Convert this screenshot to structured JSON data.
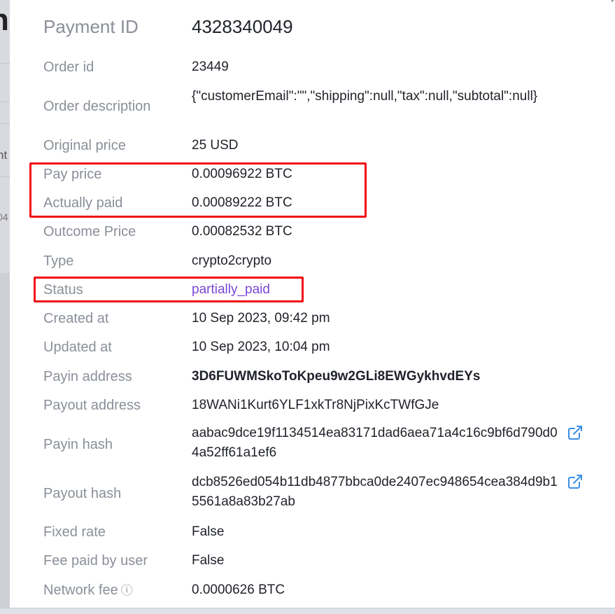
{
  "background": {
    "fragment_heading": "n",
    "fragment_tab": "nt",
    "fragment_number": "04"
  },
  "modal": {
    "close_glyph": "×",
    "title": {
      "label": "Payment ID",
      "value": "4328340049"
    },
    "rows": {
      "order_id": {
        "label": "Order id",
        "value": "23449"
      },
      "order_description": {
        "label": "Order description",
        "value": "{\"customerEmail\":\"\",\"shipping\":null,\"tax\":null,\"subtotal\":null}"
      },
      "original_price": {
        "label": "Original price",
        "value": "25 USD"
      },
      "pay_price": {
        "label": "Pay price",
        "value": "0.00096922 BTC"
      },
      "actually_paid": {
        "label": "Actually paid",
        "value": "0.00089222 BTC"
      },
      "outcome_price": {
        "label": "Outcome Price",
        "value": "0.00082532 BTC"
      },
      "type": {
        "label": "Type",
        "value": "crypto2crypto"
      },
      "status": {
        "label": "Status",
        "value": "partially_paid"
      },
      "created_at": {
        "label": "Created at",
        "value": "10 Sep 2023, 09:42 pm"
      },
      "updated_at": {
        "label": "Updated at",
        "value": "10 Sep 2023, 10:04 pm"
      },
      "payin_address": {
        "label": "Payin address",
        "value": "3D6FUWMSkoToKpeu9w2GLi8EWGykhvdEYs"
      },
      "payout_address": {
        "label": "Payout address",
        "value": "18WANi1Kurt6YLF1xkTr8NjPixKcTWfGJe"
      },
      "payin_hash": {
        "label": "Payin hash",
        "value": "aabac9dce19f1134514ea83171dad6aea71a4c16c9bf6d790d04a52ff61a1ef6"
      },
      "payout_hash": {
        "label": "Payout hash",
        "value": "dcb8526ed054b11db4877bbca0de2407ec948654cea384d9b15561a8a83b27ab"
      },
      "fixed_rate": {
        "label": "Fixed rate",
        "value": "False"
      },
      "fee_paid_by_user": {
        "label": "Fee paid by user",
        "value": "False"
      },
      "network_fee": {
        "label": "Network fee",
        "info_glyph": "ⓘ",
        "value": "0.0000626 BTC"
      }
    }
  },
  "colors": {
    "label": "#8a8f98",
    "value": "#1f2229",
    "status": "#7a47d6",
    "link_icon": "#3b8fe8",
    "highlight": "#f20d16"
  },
  "icons": {
    "external_link": "external-link-icon",
    "info": "info-icon",
    "close": "close-icon"
  }
}
